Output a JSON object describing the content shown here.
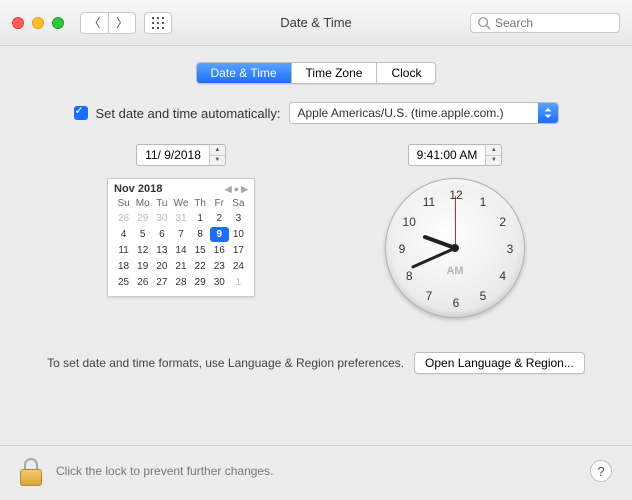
{
  "window": {
    "title": "Date & Time",
    "search_placeholder": "Search"
  },
  "tabs": {
    "t0": "Date & Time",
    "t1": "Time Zone",
    "t2": "Clock"
  },
  "auto": {
    "label": "Set date and time automatically:",
    "server": "Apple Americas/U.S. (time.apple.com.)"
  },
  "date_field": "11/ 9/2018",
  "time_field": "9:41:00 AM",
  "calendar": {
    "month": "Nov 2018",
    "dow": [
      "Su",
      "Mo",
      "Tu",
      "We",
      "Th",
      "Fr",
      "Sa"
    ],
    "cells": [
      {
        "n": "28",
        "dim": true
      },
      {
        "n": "29",
        "dim": true
      },
      {
        "n": "30",
        "dim": true
      },
      {
        "n": "31",
        "dim": true
      },
      {
        "n": "1"
      },
      {
        "n": "2"
      },
      {
        "n": "3"
      },
      {
        "n": "4"
      },
      {
        "n": "5"
      },
      {
        "n": "6"
      },
      {
        "n": "7"
      },
      {
        "n": "8"
      },
      {
        "n": "9",
        "sel": true
      },
      {
        "n": "10"
      },
      {
        "n": "11"
      },
      {
        "n": "12"
      },
      {
        "n": "13"
      },
      {
        "n": "14"
      },
      {
        "n": "15"
      },
      {
        "n": "16"
      },
      {
        "n": "17"
      },
      {
        "n": "18"
      },
      {
        "n": "19"
      },
      {
        "n": "20"
      },
      {
        "n": "21"
      },
      {
        "n": "22"
      },
      {
        "n": "23"
      },
      {
        "n": "24"
      },
      {
        "n": "25"
      },
      {
        "n": "26"
      },
      {
        "n": "27"
      },
      {
        "n": "28"
      },
      {
        "n": "29"
      },
      {
        "n": "30"
      },
      {
        "n": "1",
        "dim": true
      }
    ]
  },
  "clock": {
    "ampm": "AM",
    "numbers": [
      "12",
      "1",
      "2",
      "3",
      "4",
      "5",
      "6",
      "7",
      "8",
      "9",
      "10",
      "11"
    ],
    "hour_angle": 290,
    "minute_angle": 246,
    "second_angle": 0
  },
  "formats": {
    "hint": "To set date and time formats, use Language & Region preferences.",
    "button": "Open Language & Region..."
  },
  "footer": {
    "lock_text": "Click the lock to prevent further changes.",
    "help": "?"
  }
}
